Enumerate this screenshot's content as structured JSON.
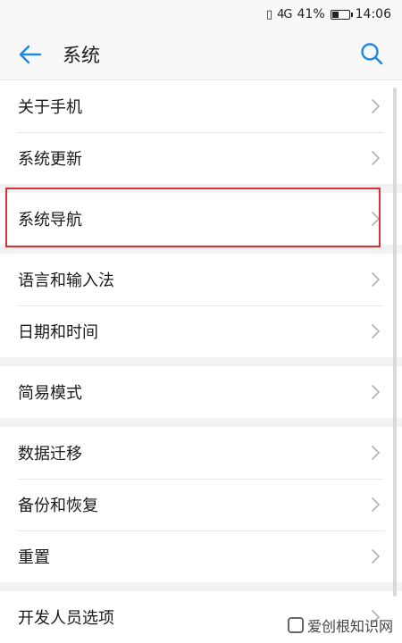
{
  "status_bar": {
    "signal": "4G",
    "battery_percent_text": "41%",
    "battery_level": 0.41,
    "time": "14:06"
  },
  "header": {
    "title": "系统",
    "back_icon": "arrow-left-icon",
    "search_icon": "search-icon",
    "accent_color": "#1e88e5"
  },
  "groups": [
    {
      "items": [
        {
          "label": "关于手机"
        },
        {
          "label": "系统更新"
        }
      ]
    },
    {
      "items": [
        {
          "label": "系统导航",
          "highlighted": true
        }
      ]
    },
    {
      "items": [
        {
          "label": "语言和输入法"
        },
        {
          "label": "日期和时间"
        }
      ]
    },
    {
      "items": [
        {
          "label": "简易模式"
        }
      ]
    },
    {
      "items": [
        {
          "label": "数据迁移"
        },
        {
          "label": "备份和恢复"
        },
        {
          "label": "重置"
        }
      ]
    },
    {
      "items": [
        {
          "label": "开发人员选项"
        }
      ]
    }
  ],
  "highlight_color": "#d9303a",
  "watermark": "爱创根知识网"
}
